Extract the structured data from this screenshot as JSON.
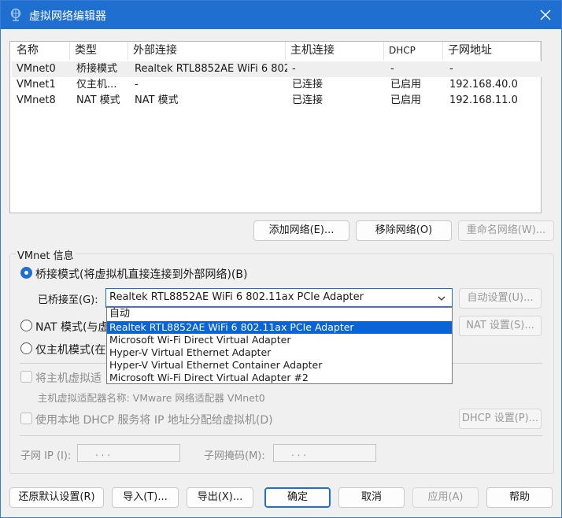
{
  "window": {
    "title": "虚拟网络编辑器"
  },
  "table": {
    "headers": [
      "名称",
      "类型",
      "外部连接",
      "主机连接",
      "DHCP",
      "子网地址"
    ],
    "rows": [
      {
        "name": "VMnet0",
        "type": "桥接模式",
        "external": "Realtek RTL8852AE WiFi 6 802....",
        "host": "-",
        "dhcp": "-",
        "subnet": "-"
      },
      {
        "name": "VMnet1",
        "type": "仅主机...",
        "external": "-",
        "host": "已连接",
        "dhcp": "已启用",
        "subnet": "192.168.40.0"
      },
      {
        "name": "VMnet8",
        "type": "NAT 模式",
        "external": "NAT 模式",
        "host": "已连接",
        "dhcp": "已启用",
        "subnet": "192.168.11.0"
      }
    ]
  },
  "list_buttons": {
    "add": "添加网络(E)...",
    "remove": "移除网络(O)",
    "rename": "重命名网络(W)..."
  },
  "vmnet_info": {
    "label": "VMnet 信息",
    "bridged_label": "桥接模式(将虚拟机直接连接到外部网络)(B)",
    "bridged_to_label": "已桥接至(G):",
    "bridged_to_value": "Realtek RTL8852AE WiFi 6 802.11ax PCIe Adapter",
    "auto_settings": "自动设置(U)...",
    "nat_label": "NAT 模式(与虚",
    "nat_settings": "NAT 设置(S)...",
    "hostonly_label": "仅主机模式(在",
    "connect_host_adapter": "将主机虚拟适",
    "host_adapter_name": "主机虚拟适配器名称: VMware 网络适配器 VMnet0",
    "use_dhcp": "使用本地 DHCP 服务将 IP 地址分配给虚拟机(D)",
    "dhcp_settings": "DHCP 设置(P)...",
    "subnet_ip_label": "子网 IP (I):",
    "subnet_mask_label": "子网掩码(M):",
    "subnet_ip_value": ".     .     .",
    "subnet_mask_value": ".     .     ."
  },
  "dropdown_options": [
    "自动",
    "Realtek RTL8852AE WiFi 6 802.11ax PCIe Adapter",
    "Microsoft Wi-Fi Direct Virtual Adapter",
    "Hyper-V Virtual Ethernet Adapter",
    "Hyper-V Virtual Ethernet Container Adapter",
    "Microsoft Wi-Fi Direct Virtual Adapter #2"
  ],
  "footer": {
    "restore": "还原默认设置(R)",
    "import": "导入(T)...",
    "export": "导出(X)...",
    "ok": "确定",
    "cancel": "取消",
    "apply": "应用(A)",
    "help": "帮助"
  },
  "colors": {
    "accent": "#1f6fd1",
    "highlight": "#0a64d6"
  }
}
